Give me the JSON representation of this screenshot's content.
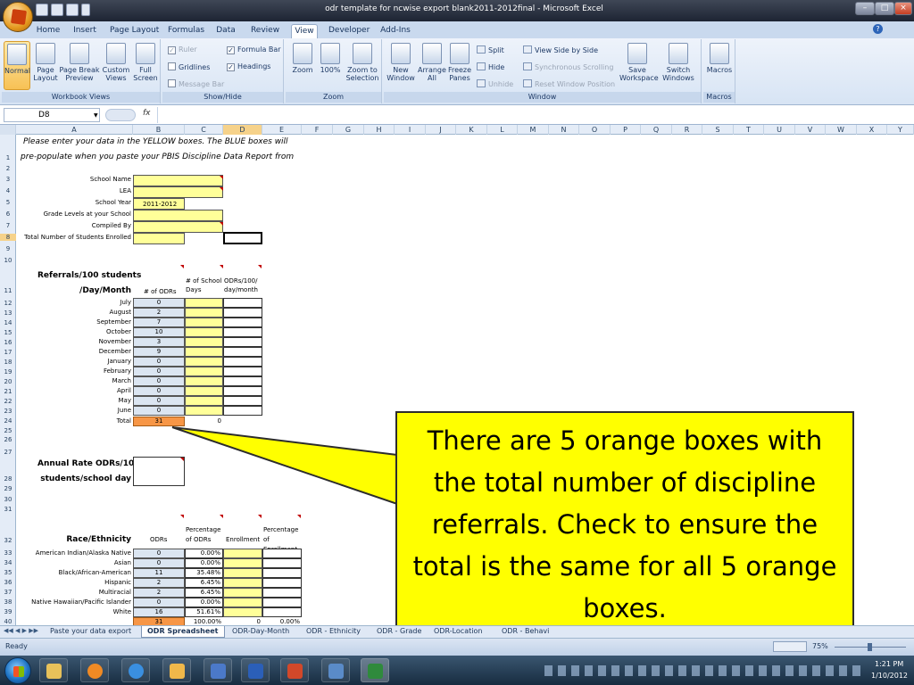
{
  "window": {
    "title": "odr template for ncwise export blank2011-2012final - Microsoft Excel"
  },
  "ribbon_tabs": [
    "Home",
    "Insert",
    "Page Layout",
    "Formulas",
    "Data",
    "Review",
    "View",
    "Developer",
    "Add-Ins"
  ],
  "active_tab": "View",
  "ribbon": {
    "workbook_views": {
      "label": "Workbook Views",
      "buttons": [
        "Normal",
        "Page Layout",
        "Page Break Preview",
        "Custom Views",
        "Full Screen"
      ]
    },
    "show_hide": {
      "label": "Show/Hide",
      "items": [
        {
          "label": "Ruler",
          "checked": true,
          "enabled": false
        },
        {
          "label": "Formula Bar",
          "checked": true,
          "enabled": true
        },
        {
          "label": "Gridlines",
          "checked": false,
          "enabled": true
        },
        {
          "label": "Headings",
          "checked": true,
          "enabled": true
        },
        {
          "label": "Message Bar",
          "checked": false,
          "enabled": false
        }
      ]
    },
    "zoom": {
      "label": "Zoom",
      "buttons": [
        "Zoom",
        "100%",
        "Zoom to Selection"
      ]
    },
    "window": {
      "label": "Window",
      "buttons": [
        "New Window",
        "Arrange All",
        "Freeze Panes"
      ],
      "small": [
        "Split",
        "Hide",
        "Unhide",
        "View Side by Side",
        "Synchronous Scrolling",
        "Reset Window Position"
      ],
      "large": [
        "Save Workspace",
        "Switch Windows"
      ]
    },
    "macros": {
      "label": "Macros",
      "buttons": [
        "Macros"
      ]
    }
  },
  "formula_bar": {
    "name_box": "D8",
    "fx": "fx",
    "formula": ""
  },
  "columns": [
    "A",
    "B",
    "C",
    "D",
    "E",
    "F",
    "G",
    "H",
    "I",
    "J",
    "K",
    "L",
    "M",
    "N",
    "O",
    "P",
    "Q",
    "R",
    "S",
    "T",
    "U",
    "V",
    "W",
    "X",
    "Y"
  ],
  "selected_column": "D",
  "selected_row": "8",
  "rows": [
    "1",
    "2",
    "3",
    "4",
    "5",
    "6",
    "7",
    "8",
    "9",
    "10",
    "11",
    "12",
    "13",
    "14",
    "15",
    "16",
    "17",
    "18",
    "19",
    "20",
    "21",
    "22",
    "23",
    "24",
    "25",
    "26",
    "27",
    "28",
    "29",
    "30",
    "31",
    "32",
    "33",
    "34",
    "35",
    "36",
    "37",
    "38",
    "39",
    "40"
  ],
  "sheet": {
    "intro_line1": "Please enter your data in the YELLOW boxes. The BLUE boxes will",
    "intro_line2": "pre-populate when you paste your PBIS Discipline Data Report from",
    "info_labels": [
      "School Name",
      "LEA",
      "School Year",
      "Grade Levels at your School",
      "Compiled By",
      "Total Number of Students Enrolled"
    ],
    "school_year": "2011-2012",
    "referrals_title_1": "Referrals/100 students",
    "referrals_title_2": "/Day/Month",
    "ref_headers": [
      "# of ODRs",
      "# of School Days",
      "ODRs/100/ day/month"
    ],
    "months": [
      {
        "name": "July",
        "odrs": "0"
      },
      {
        "name": "August",
        "odrs": "2"
      },
      {
        "name": "September",
        "odrs": "7"
      },
      {
        "name": "October",
        "odrs": "10"
      },
      {
        "name": "November",
        "odrs": "3"
      },
      {
        "name": "December",
        "odrs": "9"
      },
      {
        "name": "January",
        "odrs": "0"
      },
      {
        "name": "February",
        "odrs": "0"
      },
      {
        "name": "March",
        "odrs": "0"
      },
      {
        "name": "April",
        "odrs": "0"
      },
      {
        "name": "May",
        "odrs": "0"
      },
      {
        "name": "June",
        "odrs": "0"
      }
    ],
    "total_label": "Total",
    "total_odrs": "31",
    "total_days": "0",
    "annual_title_1": "Annual Rate ODRs/100",
    "annual_title_2": "students/school day",
    "race_title": "Race/Ethnicity",
    "race_headers": [
      "ODRs",
      "Percentage of ODRs",
      "Enrollment",
      "Percentage of Enrollment"
    ],
    "race_rows": [
      {
        "name": "American Indian/Alaska Native",
        "odrs": "0",
        "pct": "0.00%"
      },
      {
        "name": "Asian",
        "odrs": "0",
        "pct": "0.00%"
      },
      {
        "name": "Black/African-American",
        "odrs": "11",
        "pct": "35.48%"
      },
      {
        "name": "Hispanic",
        "odrs": "2",
        "pct": "6.45%"
      },
      {
        "name": "Multiracial",
        "odrs": "2",
        "pct": "6.45%"
      },
      {
        "name": "Native Hawaiian/Pacific Islander",
        "odrs": "0",
        "pct": "0.00%"
      },
      {
        "name": "White",
        "odrs": "16",
        "pct": "51.61%"
      }
    ],
    "race_total_odrs": "31",
    "race_total_pct": "100.00%",
    "race_total_enroll": "0",
    "race_total_enroll_pct": "0.00%"
  },
  "sheet_tabs": [
    "Paste your data export",
    "ODR Spreadsheet",
    "ODR-Day-Month",
    "ODR - Ethnicity",
    "ODR - Grade",
    "ODR-Location",
    "ODR - Behavi"
  ],
  "active_sheet_tab": "ODR Spreadsheet",
  "status": {
    "ready": "Ready",
    "zoom": "75%"
  },
  "clock": {
    "time": "1:21 PM",
    "date": "1/10/2012"
  },
  "callout": {
    "text": "There are 5 orange boxes with the total number of discipline referrals. Check to ensure the total is the same for all 5 orange boxes."
  },
  "colors": {
    "yellow_input": "#ffff99",
    "blue_prefill": "#dbe5f1",
    "orange_total": "#f79646",
    "callout": "#ffff00"
  }
}
